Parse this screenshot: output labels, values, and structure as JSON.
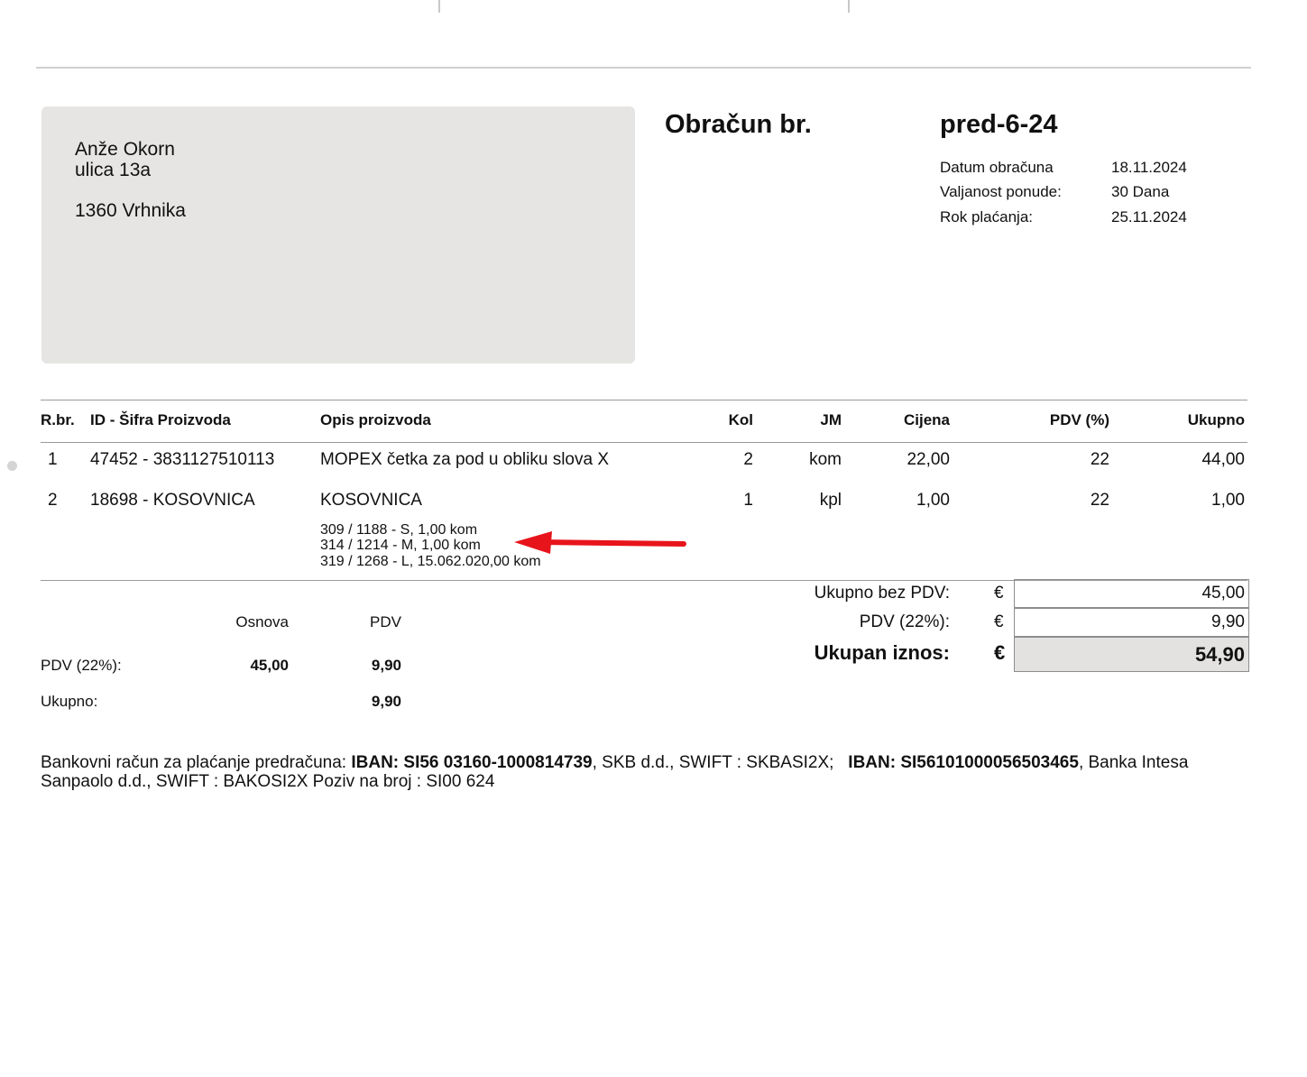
{
  "recipient": {
    "name": "Anže Okorn",
    "street": "ulica 13a",
    "city": "1360 Vrhnika"
  },
  "document": {
    "title": "Obračun br.",
    "number": "pred-6-24",
    "meta": [
      {
        "label": "Datum obračuna",
        "value": "18.11.2024"
      },
      {
        "label": "Valjanost ponude:",
        "value": "30 Dana"
      },
      {
        "label": "Rok plaćanja:",
        "value": "25.11.2024"
      }
    ]
  },
  "table": {
    "headers": {
      "rbr": "R.br.",
      "id": "ID - Šifra Proizvoda",
      "desc": "Opis proizvoda",
      "qty": "Kol",
      "unit": "JM",
      "price": "Cijena",
      "vat": "PDV (%)",
      "total": "Ukupno"
    },
    "rows": [
      {
        "rbr": "1",
        "id": "47452 - 3831127510113",
        "desc": "MOPEX četka za pod u obliku slova X",
        "qty": "2",
        "unit": "kom",
        "price": "22,00",
        "vat": "22",
        "total": "44,00",
        "sub": []
      },
      {
        "rbr": "2",
        "id": "18698 - KOSOVNICA",
        "desc": "KOSOVNICA",
        "qty": "1",
        "unit": "kpl",
        "price": "1,00",
        "vat": "22",
        "total": "1,00",
        "sub": [
          "309 / 1188 - S, 1,00 kom",
          "314 / 1214 - M, 1,00 kom",
          "319 / 1268 - L, 15.062.020,00 kom"
        ]
      }
    ]
  },
  "totals": {
    "currency": "€",
    "net_label": "Ukupno bez PDV:",
    "net_value": "45,00",
    "vat_label": "PDV (22%):",
    "vat_value": "9,90",
    "grand_label": "Ukupan iznos:",
    "grand_value": "54,90",
    "grand_bg": "#e3e2e0"
  },
  "vat_summary": {
    "col_base": "Osnova",
    "col_vat": "PDV",
    "rate_label": "PDV (22%):",
    "rate_base": "45,00",
    "rate_vat": "9,90",
    "total_label": "Ukupno:",
    "total_vat": "9,90"
  },
  "bank": {
    "prefix": "Bankovni račun za plaćanje predračuna: ",
    "iban1": "IBAN: SI56 03160-1000814739",
    "mid": ", SKB d.d., SWIFT : SKBASI2X;   ",
    "iban2": "IBAN: SI56101000056503465",
    "suffix": ", Banka Intesa Sanpaolo d.d., SWIFT : BAKOSI2X Poziv na broj : SI00 624"
  },
  "annotation": {
    "arrow_color": "#e8141b"
  }
}
